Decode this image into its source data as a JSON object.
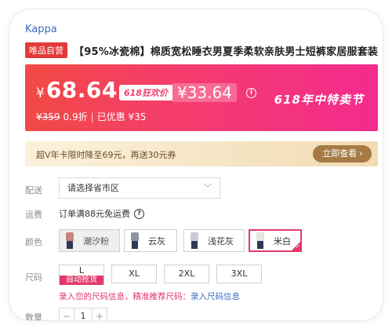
{
  "brand": "Kappa",
  "product": {
    "tag": "唯品自营",
    "title": "【95%冰瓷棉】棉质宽松睡衣男夏季柔软亲肤男士短裤家居服套装"
  },
  "price": {
    "currency": "¥",
    "current": "68.64",
    "promo_label": "618狂欢价",
    "promo_price": "¥33.64",
    "info_icon": "i",
    "festival_text": "618年中特卖节",
    "original": "¥359",
    "discount": "0.9折",
    "separator": "|",
    "saving": "已优惠 ¥35"
  },
  "vip": {
    "text": "超V年卡限时降至69元，再送30元券",
    "button": "立即查看 ›"
  },
  "shipping": {
    "label": "配送",
    "placeholder": "请选择省市区",
    "chevron": "﹀"
  },
  "fee": {
    "label": "运费",
    "text": "订单满88元免运费",
    "help_icon": "?"
  },
  "color": {
    "label": "颜色",
    "options": [
      {
        "name": "潮汐粉",
        "shirt": "#c9857c",
        "state": "disabled"
      },
      {
        "name": "云灰",
        "shirt": "#8f939b",
        "state": "normal"
      },
      {
        "name": "浅花灰",
        "shirt": "#c9ccd2",
        "state": "normal"
      },
      {
        "name": "米白",
        "shirt": "#e9e6df",
        "state": "selected"
      }
    ],
    "check": "✓"
  },
  "size": {
    "label": "尺码",
    "options": [
      "L",
      "XL",
      "2XL",
      "3XL"
    ],
    "auto_label": "自动抢货",
    "hint": "录入您的尺码信息，精准推荐尺码：",
    "hint_link": "录入尺码信息"
  },
  "quantity": {
    "label": "数量",
    "minus": "−",
    "value": "1",
    "plus": "+"
  }
}
